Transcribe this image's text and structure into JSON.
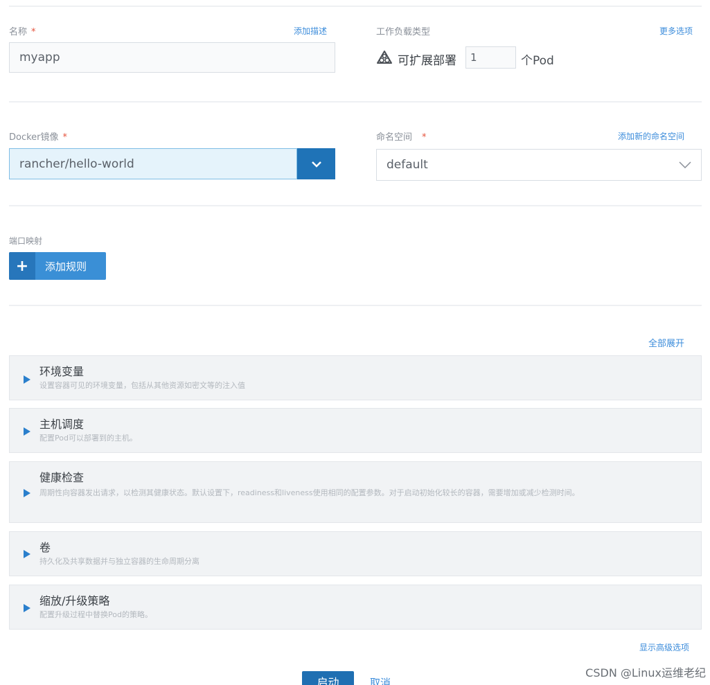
{
  "form": {
    "name": {
      "label": "名称",
      "required_mark": "*",
      "add_description_link": "添加描述",
      "value": "myapp"
    },
    "workload_type": {
      "label": "工作负载类型",
      "more_options_link": "更多选项",
      "type_text": "可扩展部署",
      "replicas_value": "1",
      "unit_text": "个Pod"
    },
    "docker_image": {
      "label": "Docker镜像",
      "required_mark": "*",
      "value": "rancher/hello-world"
    },
    "namespace": {
      "label": "命名空间",
      "required_mark": "*",
      "add_namespace_link": "添加新的命名空间",
      "value": "default"
    },
    "port_mapping": {
      "label": "端口映射",
      "add_rule_button": "添加规则"
    },
    "expand_all_link": "全部展开",
    "sections": [
      {
        "title": "环境变量",
        "description": "设置容器可见的环境变量，包括从其他资源如密文等的注入值"
      },
      {
        "title": "主机调度",
        "description": "配置Pod可以部署到的主机。"
      },
      {
        "title": "健康检查",
        "description": "周期性向容器发出请求，以检测其健康状态。默认设置下，readiness和liveness使用相同的配置参数。对于启动初始化较长的容器，需要增加或减少检测时间。"
      },
      {
        "title": "卷",
        "description": "持久化及共享数据并与独立容器的生命周期分离"
      },
      {
        "title": "缩放/升级策略",
        "description": "配置升级过程中替换Pod的策略。"
      }
    ],
    "show_advanced_link": "显示高级选项",
    "create_button": "启动",
    "cancel_link": "取消"
  },
  "watermark": "CSDN @Linux运维老纪",
  "colors": {
    "primary": "#1f73b7",
    "link": "#3d8ddb",
    "required": "#e5533d",
    "section_bg": "#f1f3f5"
  }
}
